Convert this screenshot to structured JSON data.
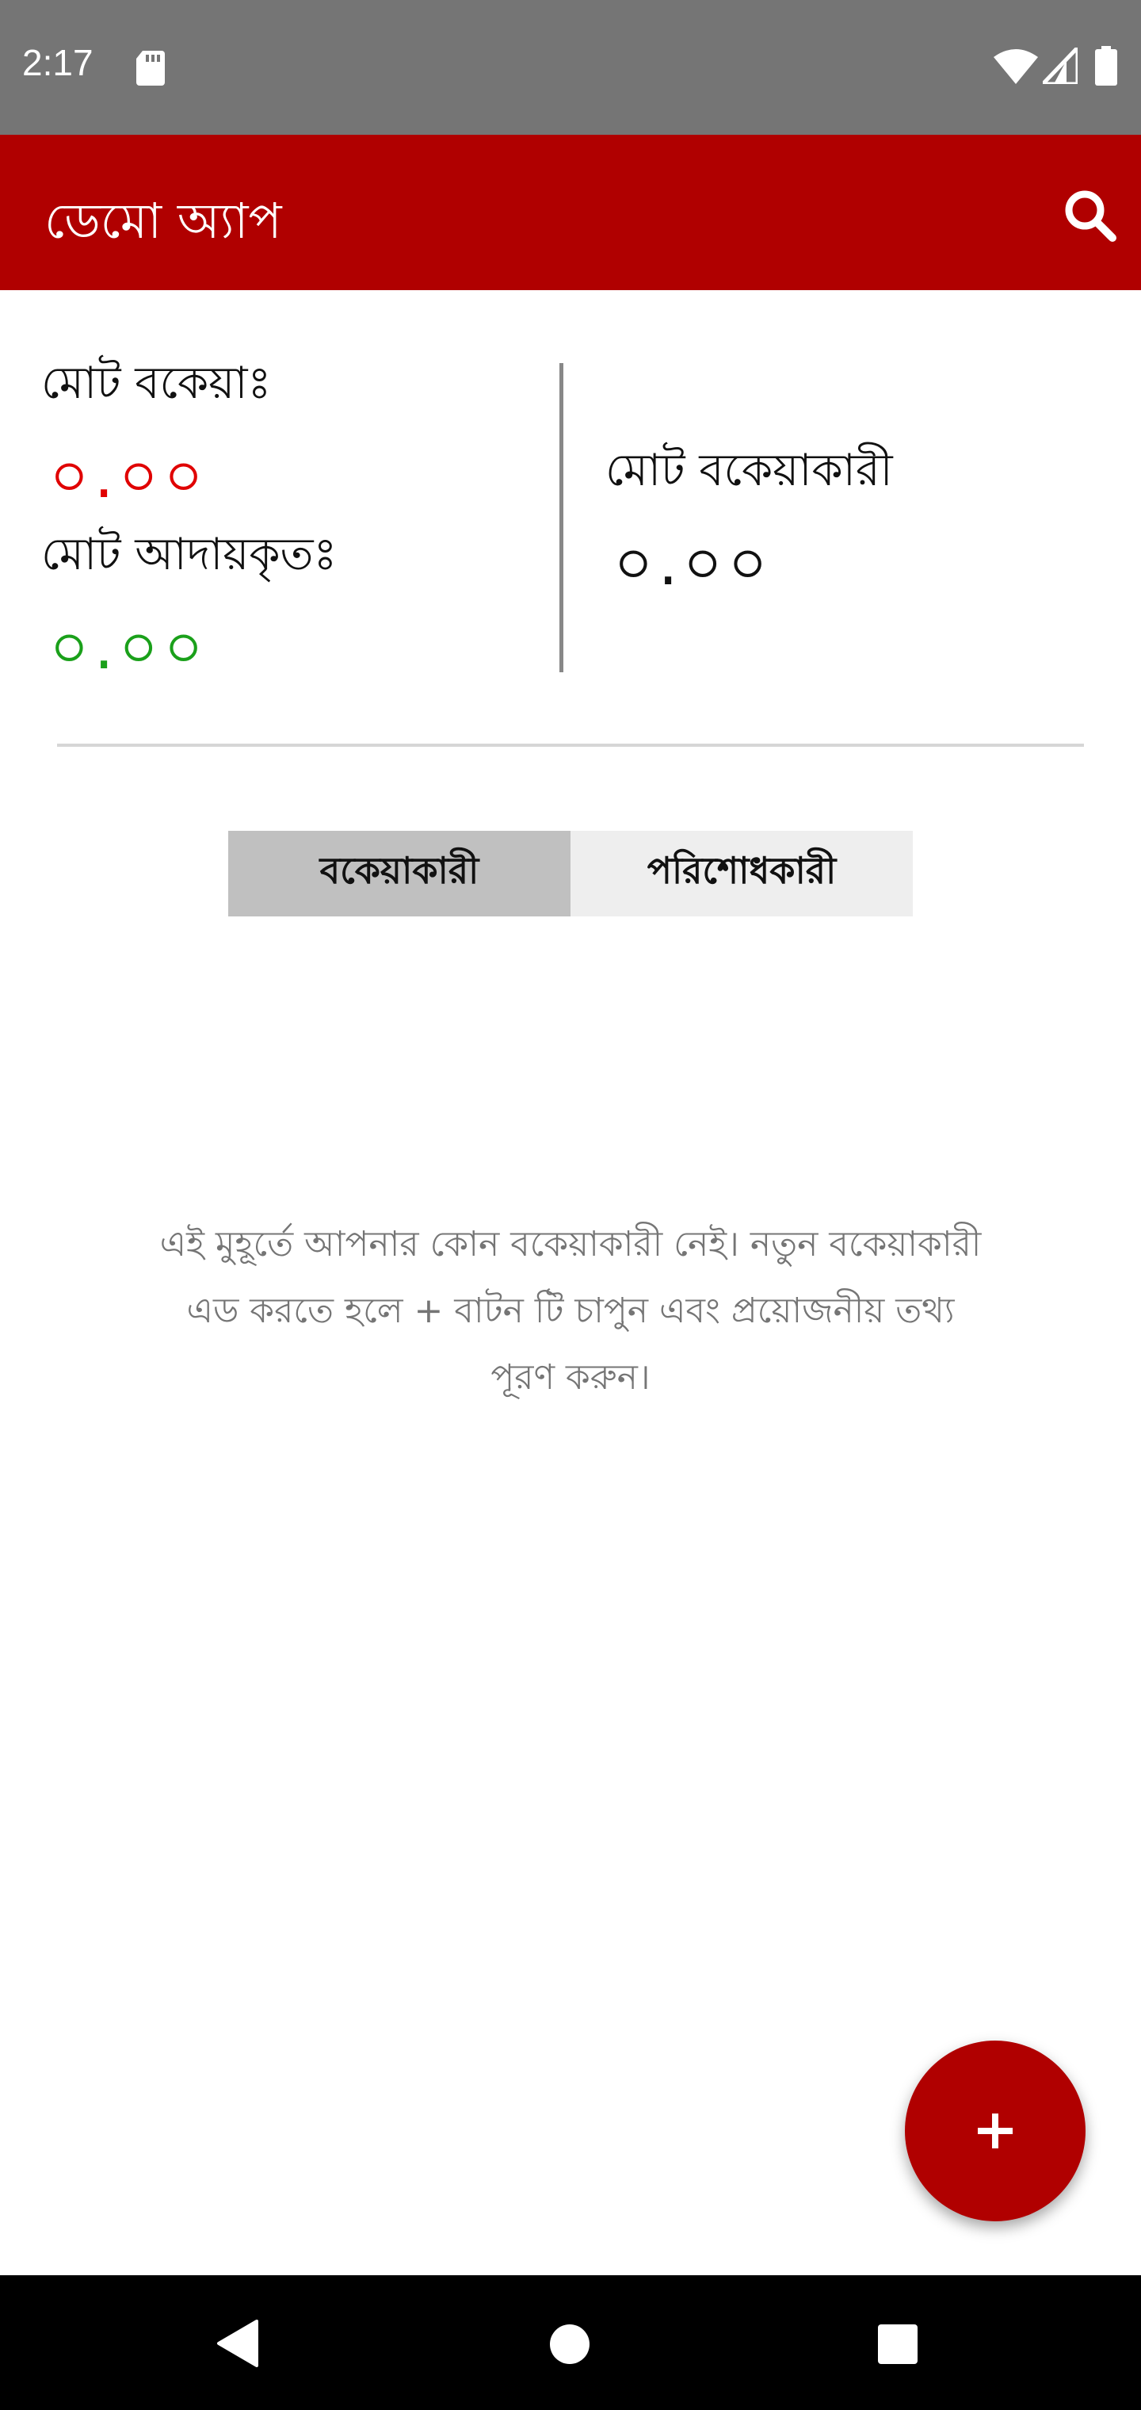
{
  "status_bar": {
    "time": "2:17",
    "icons": [
      "sd-card-icon",
      "wifi-icon",
      "signal-icon",
      "battery-icon"
    ]
  },
  "app_bar": {
    "title": "ডেমো অ্যাপ",
    "search_icon": "search-icon"
  },
  "summary": {
    "total_due_label": "মোট বকেয়াঃ",
    "total_due_value": "০.০০",
    "total_collected_label": "মোট আদায়কৃতঃ",
    "total_collected_value": "০.০০",
    "total_debtors_label": "মোট বকেয়াকারী",
    "total_debtors_value": "০.০০"
  },
  "tabs": [
    {
      "label": "বকেয়াকারী",
      "active": true
    },
    {
      "label": "পরিশোধকারী",
      "active": false
    }
  ],
  "empty_state": {
    "message": "এই মুহূর্তে আপনার কোন বকেয়াকারী নেই। নতুন বকেয়াকারী এড করতে হলে + বাটন টি চাপুন এবং প্রয়োজনীয় তথ্য পূরণ করুন।"
  },
  "fab": {
    "label": "+"
  },
  "nav_bar": {
    "icons": [
      "back-icon",
      "home-icon",
      "recents-icon"
    ]
  },
  "colors": {
    "brand": "#b00000",
    "due": "#e00000",
    "collected": "#1aa01a",
    "status_bar": "#757575",
    "tab_active": "#c0c0c0",
    "tab_inactive": "#eeeeee"
  }
}
